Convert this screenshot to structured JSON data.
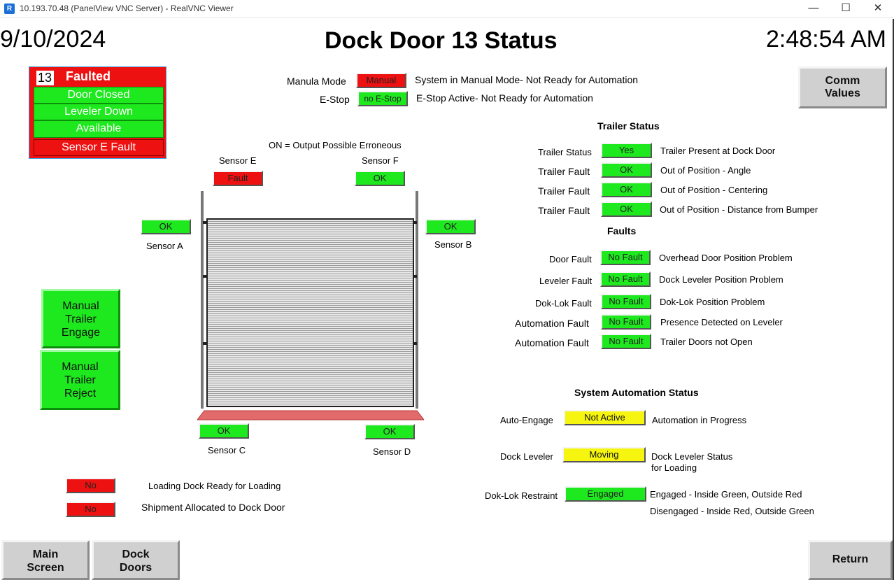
{
  "window": {
    "title": "10.193.70.48 (PanelView VNC Server) - RealVNC Viewer",
    "min": "—",
    "max": "☐",
    "close": "✕"
  },
  "header": {
    "date": "9/10/2024",
    "title": "Dock Door 13 Status",
    "time": "2:48:54 AM"
  },
  "status_box": {
    "door_number": "13",
    "state": "Faulted",
    "rows": [
      "Door Closed",
      "Leveler Down",
      "Available"
    ],
    "fault": "Sensor E Fault"
  },
  "modes": {
    "manual_label": "Manula Mode",
    "manual_value": "Manual",
    "manual_desc": "System in Manual Mode- Not Ready for Automation",
    "estop_label": "E-Stop",
    "estop_value": "no E-Stop",
    "estop_desc": "E-Stop Active- Not Ready for Automation"
  },
  "comm_button": {
    "line1": "Comm",
    "line2": "Values"
  },
  "sensors": {
    "note": "ON = Output Possible Erroneous",
    "e": {
      "label": "Sensor E",
      "value": "Fault"
    },
    "f": {
      "label": "Sensor F",
      "value": "OK"
    },
    "a": {
      "label": "Sensor A",
      "value": "OK"
    },
    "b": {
      "label": "Sensor B",
      "value": "OK"
    },
    "c": {
      "label": "Sensor C",
      "value": "OK"
    },
    "d": {
      "label": "Sensor D",
      "value": "OK"
    }
  },
  "manual_buttons": {
    "engage": [
      "Manual",
      "Trailer",
      "Engage"
    ],
    "reject": [
      "Manual",
      "Trailer",
      "Reject"
    ]
  },
  "trailer_status": {
    "heading": "Trailer Status",
    "rows": [
      {
        "label": "Trailer Status",
        "value": "Yes",
        "desc": "Trailer Present at Dock Door"
      },
      {
        "label": "Trailer Fault",
        "value": "OK",
        "desc": "Out of Position - Angle"
      },
      {
        "label": "Trailer Fault",
        "value": "OK",
        "desc": "Out of Position - Centering"
      },
      {
        "label": "Trailer Fault",
        "value": "OK",
        "desc": "Out of Position - Distance from Bumper"
      }
    ]
  },
  "faults": {
    "heading": "Faults",
    "rows": [
      {
        "label": "Door Fault",
        "value": "No Fault",
        "desc": "Overhead Door Position Problem"
      },
      {
        "label": "Leveler Fault",
        "value": "No Fault",
        "desc": "Dock Leveler Position Problem"
      },
      {
        "label": "Dok-Lok Fault",
        "value": "No Fault",
        "desc": "Dok-Lok Position Problem"
      },
      {
        "label": "Automation Fault",
        "value": "No Fault",
        "desc": "Presence Detected on Leveler"
      },
      {
        "label": "Automation Fault",
        "value": "No Fault",
        "desc": "Trailer Doors not Open"
      }
    ]
  },
  "automation": {
    "heading": "System Automation Status",
    "auto_engage": {
      "label": "Auto-Engage",
      "value": "Not Active",
      "desc": "Automation in Progress"
    },
    "dock_leveler": {
      "label": "Dock Leveler",
      "value": "Moving",
      "desc1": "Dock Leveler Status",
      "desc2": "for Loading"
    },
    "doklok": {
      "label": "Dok-Lok Restraint",
      "value": "Engaged",
      "desc1": "Engaged - Inside Green, Outside Red",
      "desc2": "Disengaged - Inside Red, Outside Green"
    }
  },
  "loading": {
    "ready": {
      "value": "No",
      "desc": "Loading Dock Ready for Loading"
    },
    "allocated": {
      "value": "No",
      "desc": "Shipment Allocated to Dock Door"
    }
  },
  "footer": {
    "main": [
      "Main",
      "Screen"
    ],
    "dock": [
      "Dock",
      "Doors"
    ],
    "return": "Return"
  }
}
